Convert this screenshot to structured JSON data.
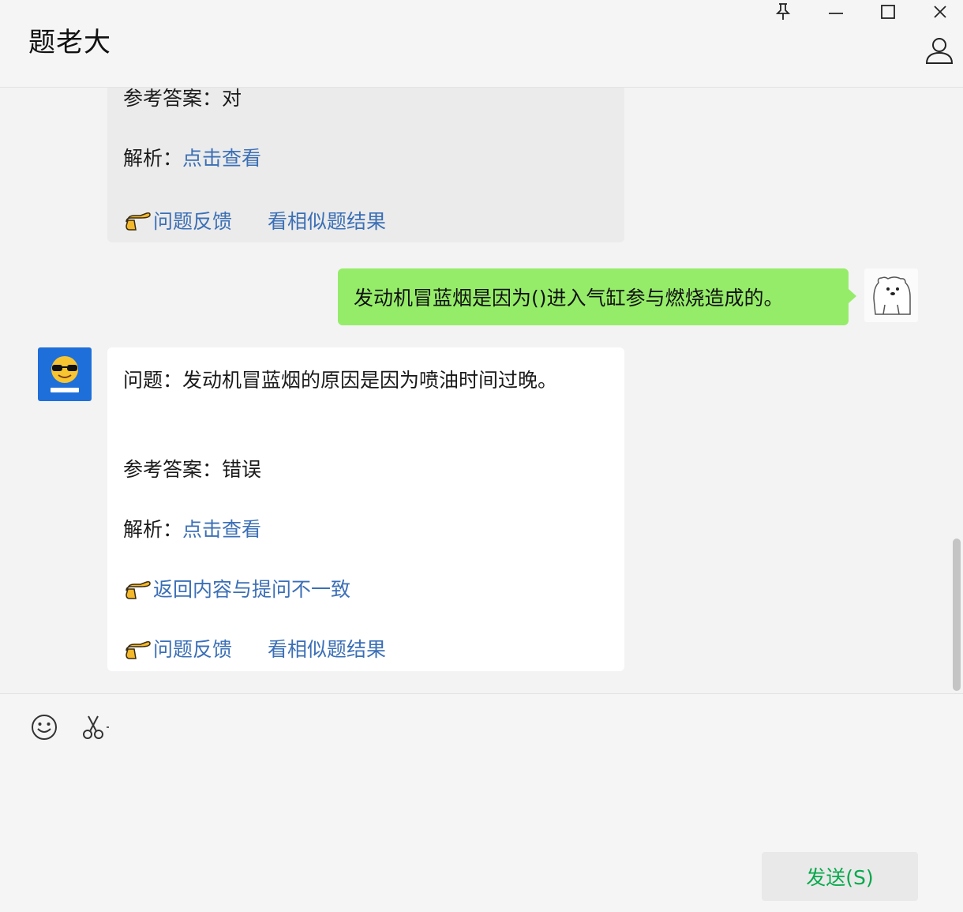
{
  "app": {
    "title": "题老大"
  },
  "window_controls": {
    "pin_icon": "pin-icon",
    "minimize_icon": "minimize-icon",
    "maximize_icon": "maximize-icon",
    "close_icon": "close-icon",
    "profile_icon": "user-icon"
  },
  "messages": {
    "prev_reply": {
      "answer_line": "参考答案：对",
      "analysis_label": "解析：",
      "analysis_link": "点击查看",
      "feedback_link": "问题反馈",
      "similar_link": "看相似题结果"
    },
    "user_message": {
      "text": "发动机冒蓝烟是因为()进入气缸参与燃烧造成的。"
    },
    "bot_reply": {
      "question": "问题：发动机冒蓝烟的原因是因为喷油时间过晚。",
      "answer_line": "参考答案：错误",
      "analysis_label": "解析：",
      "analysis_link": "点击查看",
      "mismatch_link": "返回内容与提问不一致",
      "feedback_link": "问题反馈",
      "similar_link": "看相似题结果"
    }
  },
  "input": {
    "emoji_icon": "emoji-icon",
    "screenshot_icon": "scissors-icon",
    "send_label": "发送(S)"
  },
  "colors": {
    "user_bubble": "#95ec69",
    "link": "#3b6fb6",
    "send_text": "#07a84c",
    "bot_avatar_bg": "#1e6fd9"
  }
}
